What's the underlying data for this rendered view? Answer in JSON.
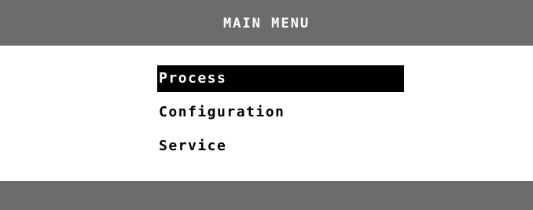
{
  "window": {
    "title": "MAIN MENU"
  },
  "menu": {
    "items": [
      {
        "label": "Process",
        "selected": true
      },
      {
        "label": "Configuration",
        "selected": false
      },
      {
        "label": "Service",
        "selected": false
      }
    ]
  },
  "colors": {
    "chrome": "#6c6c6c",
    "background": "#ffffff",
    "highlight": "#000000",
    "title_text": "#ffffff"
  }
}
